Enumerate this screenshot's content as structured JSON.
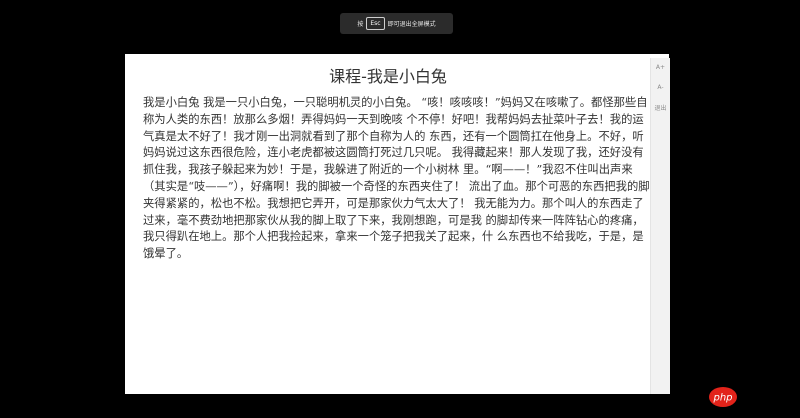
{
  "fullscreen_hint": {
    "prefix": "按",
    "key": "Esc",
    "suffix": "即可退出全屏模式"
  },
  "reader": {
    "title": "课程-我是小白兔",
    "body": "我是小白兔  我是一只小白兔，一只聪明机灵的小白兔。 “咳！咳咳咳！”妈妈又在咳嗽了。都怪那些自称为人类的东西！放那么多烟！弄得妈妈一天到晚咳  个不停！好吧！我帮妈妈去扯菜叶子去！我的运气真是太不好了！我才刚一出洞就看到了那个自称为人的  东西，还有一个圆筒扛在他身上。不好，听妈妈说过这东西很危险，连小老虎都被这圆筒打死过几只呢。  我得藏起来！那人发现了我，还好没有抓住我，我孩子躲起来为妙！于是，我躲进了附近的一个小树林  里。“啊——！”我忍不住叫出声来（其实是“吱——”），好痛啊！我的脚被一个奇怪的东西夹住了！  流出了血。那个可恶的东西把我的脚夹得紧紧的，松也不松。我想把它弄开，可是那家伙力气太大了！  我无能为力。那个叫人的东西走了过来，毫不费劲地把那家伙从我的脚上取了下来，我刚想跑，可是我  的脚却传来一阵阵钻心的疼痛，我只得趴在地上。那个人把我捡起来，拿来一个笼子把我关了起来，什  么东西也不给我吃，于是，是饿晕了。"
  },
  "tools": {
    "increase_font": "A+",
    "decrease_font": "A-",
    "exit": "退出"
  },
  "brand": {
    "logo_text": "php",
    "logo_color": "#e2231a"
  }
}
